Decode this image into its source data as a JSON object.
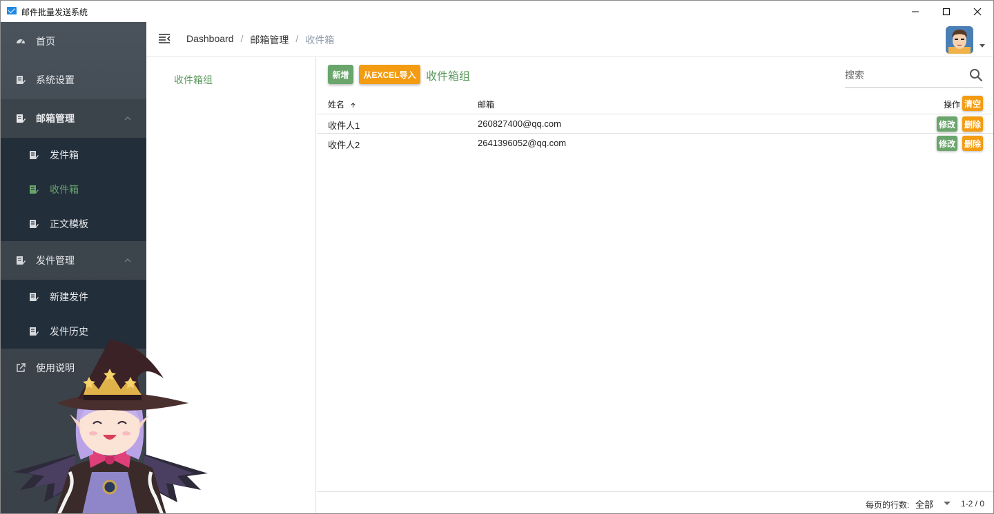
{
  "window": {
    "title": "邮件批量发送系统",
    "icon": "mail-icon",
    "controls": [
      "minimize-icon",
      "maximize-icon",
      "close-icon"
    ]
  },
  "sidebar": {
    "items": [
      {
        "label": "首页",
        "icon": "dashboard-icon"
      },
      {
        "label": "系统设置",
        "icon": "edit-doc-icon"
      },
      {
        "label": "邮箱管理",
        "icon": "edit-doc-icon",
        "expanded": true,
        "children": [
          {
            "label": "发件箱",
            "icon": "edit-doc-icon"
          },
          {
            "label": "收件箱",
            "icon": "edit-doc-icon",
            "selected": true
          },
          {
            "label": "正文模板",
            "icon": "edit-doc-icon"
          }
        ]
      },
      {
        "label": "发件管理",
        "icon": "edit-doc-icon",
        "expanded": true,
        "children": [
          {
            "label": "新建发件",
            "icon": "edit-doc-icon"
          },
          {
            "label": "发件历史",
            "icon": "edit-doc-icon"
          }
        ]
      },
      {
        "label": "使用说明",
        "icon": "external-link-icon"
      }
    ]
  },
  "header": {
    "breadcrumb": [
      "Dashboard",
      "邮箱管理",
      "收件箱"
    ]
  },
  "groups": {
    "items": [
      "收件箱组"
    ]
  },
  "toolbar": {
    "add_label": "新增",
    "import_label": "从EXCEL导入",
    "section_title": "收件箱组",
    "search_placeholder": "搜索"
  },
  "table": {
    "columns": {
      "name": "姓名",
      "email": "邮箱",
      "actions": "操作"
    },
    "clear_label": "清空",
    "sort": "ascending",
    "rows": [
      {
        "name": "收件人1",
        "email": "260827400@qq.com",
        "edit": "修改",
        "delete": "删除"
      },
      {
        "name": "收件人2",
        "email": "2641396052@qq.com",
        "edit": "修改",
        "delete": "删除"
      }
    ]
  },
  "footer": {
    "rows_per_page_label": "每页的行数:",
    "rows_per_page_value": "全部",
    "range": "1-2 / 0"
  },
  "colors": {
    "accent_green": "#6aa56c",
    "accent_orange": "#f39c12",
    "sidebar_bg": "#3c444c",
    "submenu_bg": "#222e3a"
  }
}
